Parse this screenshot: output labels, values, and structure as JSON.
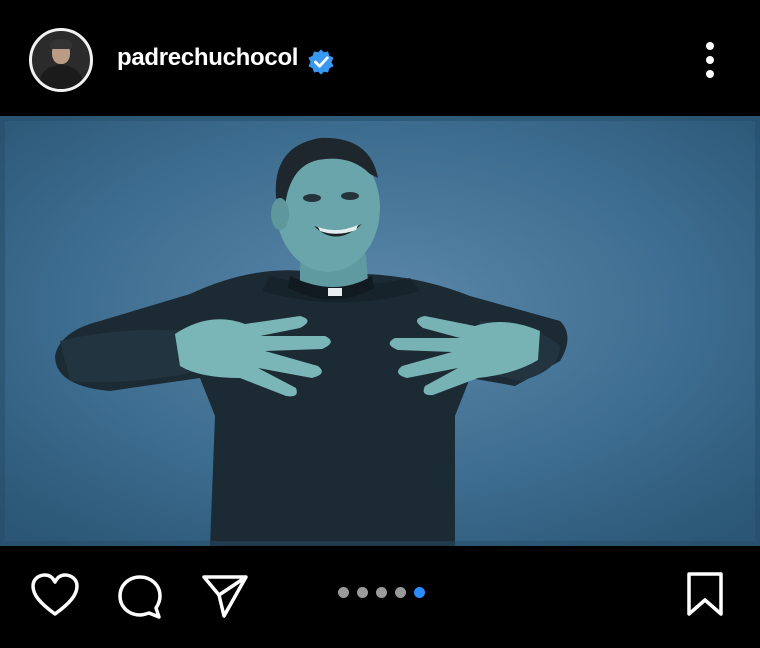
{
  "header": {
    "username": "padrechuchocol",
    "verified": true,
    "avatar_icon": "profile-photo",
    "more_icon": "more-vertical-icon"
  },
  "post": {
    "image_icon": "post-photo",
    "carousel": {
      "total": 5,
      "active_index": 4
    }
  },
  "actions": {
    "like_icon": "heart-icon",
    "comment_icon": "comment-icon",
    "share_icon": "share-icon",
    "save_icon": "bookmark-icon"
  },
  "colors": {
    "background": "#000000",
    "verified": "#3897f0",
    "active_dot": "#2a8cff",
    "inactive_dot": "#9a9a9a"
  }
}
